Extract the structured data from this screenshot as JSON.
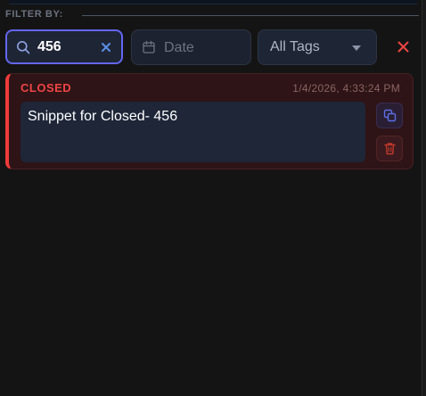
{
  "filter": {
    "label": "FILTER BY:",
    "search": {
      "value": "456",
      "placeholder": "Search"
    },
    "date": {
      "placeholder": "Date"
    },
    "tags": {
      "selected": "All Tags"
    }
  },
  "snippets": [
    {
      "status": "CLOSED",
      "timestamp": "1/4/2026, 4:33:24 PM",
      "text": "Snippet for Closed- 456"
    }
  ],
  "colors": {
    "accent": "#6366f1",
    "status_closed": "#ef4444",
    "background": "#141414"
  },
  "icons": [
    "search-icon",
    "clear-icon",
    "calendar-icon",
    "chevron-down-icon",
    "close-icon",
    "copy-icon",
    "trash-icon"
  ]
}
